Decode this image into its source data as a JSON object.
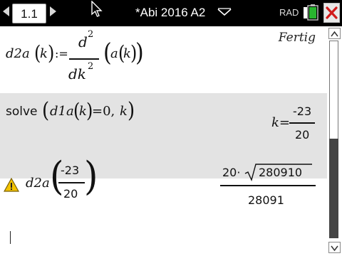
{
  "topbar": {
    "tab_label": "1.1",
    "document_title": "*Abi 2016 A2",
    "angle_mode": "RAD"
  },
  "entries": [
    {
      "input": {
        "name_fn": "d2a",
        "arg": "k",
        "assign": ":=",
        "d_symbol": "d",
        "exp": "2",
        "dk": "dk",
        "inner": "a",
        "inner_arg": "k"
      },
      "output": "Fertig"
    },
    {
      "input": {
        "command": "solve",
        "fn": "d1a",
        "arg": "k",
        "eq": "=0,",
        "var": "k"
      },
      "output": {
        "lhs": "k=",
        "num": "-23",
        "den": "20"
      }
    },
    {
      "warning": true,
      "input": {
        "fn": "d2a",
        "num": "-23",
        "den": "20"
      },
      "output": {
        "coef": "20·",
        "radicand": "280910",
        "den": "28091"
      }
    }
  ],
  "icons": [
    "left-arrow-icon",
    "right-arrow-icon",
    "mouse-pointer-icon",
    "dropdown-icon",
    "battery-icon",
    "close-icon",
    "warning-icon",
    "scroll-up-icon",
    "scroll-down-icon"
  ],
  "colors": {
    "topbar": "#000000",
    "shade": "#e3e3e3",
    "close": "#d11a1a",
    "warning": "#f2c200"
  },
  "scroll": {
    "position": 1.0
  }
}
